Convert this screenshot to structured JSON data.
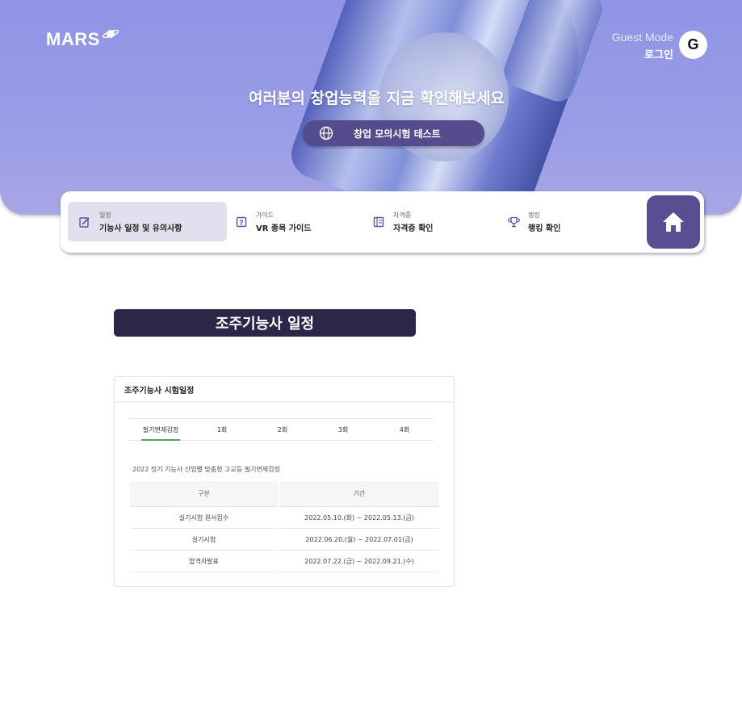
{
  "brand": {
    "logo_text": "MARS"
  },
  "account": {
    "mode": "Guest Mode",
    "login_label": "로그인",
    "avatar_letter": "G"
  },
  "hero": {
    "headline": "여러분의 창업능력을 지금 확인해보세요",
    "cta_label": "창업 모의시험 테스트",
    "cta_icon": "globe-icon"
  },
  "nav": {
    "items": [
      {
        "category": "일정",
        "label": "기능사 일정 및 유의사항",
        "icon": "edit-icon"
      },
      {
        "category": "가이드",
        "label": "VR 종목 가이드",
        "icon": "question-icon"
      },
      {
        "category": "자격증",
        "label": "자격증 확인",
        "icon": "certificate-icon"
      },
      {
        "category": "랭킹",
        "label": "랭킹 확인",
        "icon": "trophy-icon"
      }
    ],
    "home_icon": "home-icon"
  },
  "section": {
    "title": "조주기능사 일정"
  },
  "schedule": {
    "card_title": "조주기능사 시험일정",
    "tabs": [
      "필기면제검정",
      "1회",
      "2회",
      "3회",
      "4회"
    ],
    "active_tab": "필기면제검정",
    "notice": "2022 정기 기능사 산업별 맞춤형 고교등 필기면제검정",
    "columns": [
      "구분",
      "기간"
    ],
    "rows": [
      {
        "item": "실기시험 원서접수",
        "period": "2022.05.10.(화) ~ 2022.05.13.(금)"
      },
      {
        "item": "실기시험",
        "period": "2022.06.20.(월) ~ 2022.07.01(금)"
      },
      {
        "item": "합격자발표",
        "period": "2022.07.22.(금) ~ 2022.09.21.(수)"
      }
    ]
  },
  "colors": {
    "hero": "#8f94e4",
    "accent": "#574f91",
    "title_bar": "#2e2649",
    "tab_underline": "#55a85a"
  }
}
